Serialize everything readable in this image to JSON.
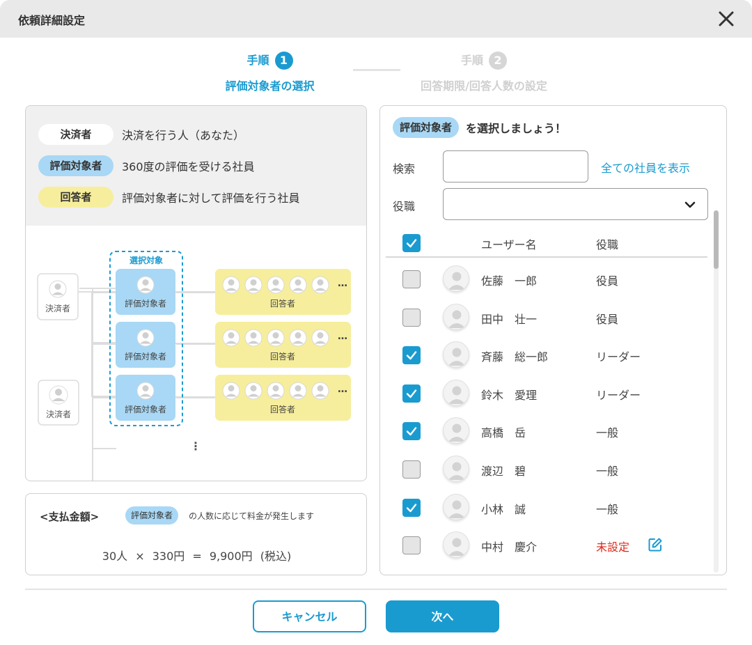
{
  "window": {
    "title": "依頼詳細設定"
  },
  "steps": [
    {
      "label": "手順",
      "number": "1",
      "title": "評価対象者の選択",
      "active": true
    },
    {
      "label": "手順",
      "number": "2",
      "title": "回答期限/回答人数の設定",
      "active": false
    }
  ],
  "legend": [
    {
      "tag": "決済者",
      "description": "決済を行う人（あなた）"
    },
    {
      "tag": "評価対象者",
      "description": "360度の評価を受ける社員"
    },
    {
      "tag": "回答者",
      "description": "評価対象者に対して評価を行う社員"
    }
  ],
  "diagram": {
    "approver_label": "決済者",
    "selection_label": "選択対象",
    "target_label": "評価対象者",
    "respondent_label": "回答者",
    "more": "…",
    "continue": "⋮"
  },
  "payment": {
    "title": "<支払金額>",
    "tag": "評価対象者",
    "note": "の人数に応じて料金が発生します",
    "calculation": "30人 × 330円 = 9,900円 (税込)"
  },
  "selection": {
    "header_tag": "評価対象者",
    "header_text": "を選択しましょう！",
    "search_label": "検索",
    "search_value": "",
    "show_all_link": "全ての社員を表示",
    "role_label": "役職",
    "role_value": "",
    "columns": {
      "username": "ユーザー名",
      "role": "役職"
    },
    "select_all_checked": true,
    "rows": [
      {
        "name": "佐藤　一郎",
        "role": "役員",
        "checked": false
      },
      {
        "name": "田中　壮一",
        "role": "役員",
        "checked": false
      },
      {
        "name": "斉藤　総一郎",
        "role": "リーダー",
        "checked": true
      },
      {
        "name": "鈴木　愛理",
        "role": "リーダー",
        "checked": true
      },
      {
        "name": "高橋　岳",
        "role": "一般",
        "checked": true
      },
      {
        "name": "渡辺　碧",
        "role": "一般",
        "checked": false
      },
      {
        "name": "小林　誠",
        "role": "一般",
        "checked": true
      },
      {
        "name": "中村　慶介",
        "role": "未設定",
        "checked": false,
        "unset": true
      }
    ]
  },
  "buttons": {
    "cancel": "キャンセル",
    "next": "次へ"
  },
  "colors": {
    "accent": "#1a9bd0",
    "target_tag": "#a8d8f5",
    "respondent_tag": "#f6ee9c",
    "unset": "#e0281a"
  }
}
